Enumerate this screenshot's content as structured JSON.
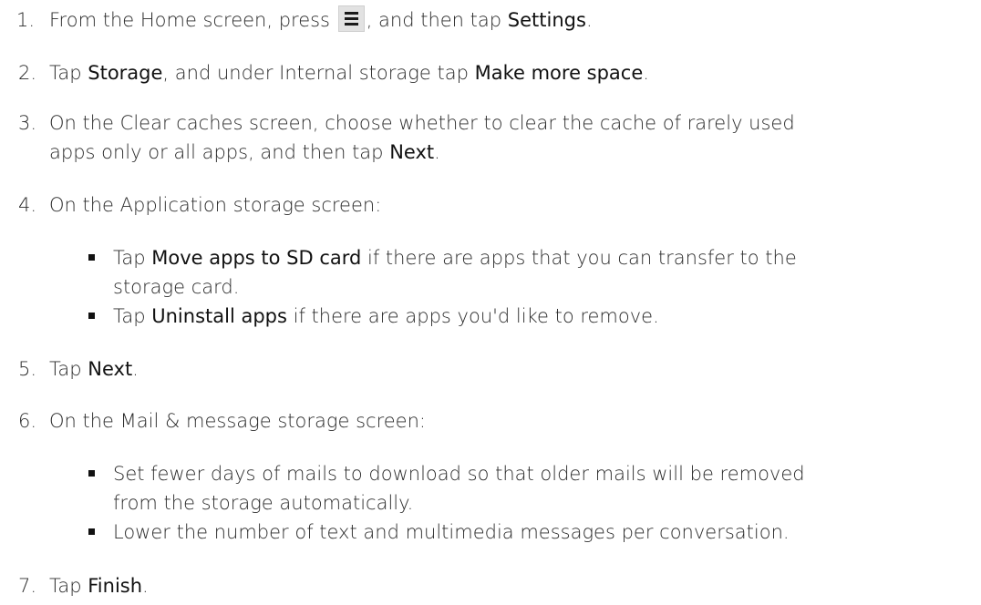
{
  "steps": [
    {
      "num": "1.",
      "pre": "From the Home screen, press",
      "icon": "menu-icon",
      "mid": ", and then tap",
      "b1": "Settings",
      "post": "."
    },
    {
      "num": "2.",
      "pre": "Tap",
      "b1": "Storage",
      "mid": ", and under Internal storage tap",
      "b2": "Make more space",
      "post": "."
    },
    {
      "num": "3.",
      "line1": "On the Clear caches screen, choose whether to clear the cache of rarely used",
      "line2_pre": "apps only or all apps, and then tap",
      "b1": "Next",
      "post": "."
    },
    {
      "num": "4.",
      "text": "On the Application storage screen:",
      "bullets": [
        {
          "pre": "Tap",
          "b1": "Move apps to SD card",
          "post1": "if there are apps that you can transfer to the",
          "line2": "storage card."
        },
        {
          "pre": "Tap",
          "b1": "Uninstall apps",
          "post1": "if there are apps you'd like to remove."
        }
      ]
    },
    {
      "num": "5.",
      "pre": "Tap",
      "b1": "Next",
      "post": "."
    },
    {
      "num": "6.",
      "text": "On the Mail & message storage screen:",
      "bullets": [
        {
          "line1": "Set fewer days of mails to download so that older mails will be removed",
          "line2": "from the storage automatically."
        },
        {
          "line1": "Lower the number of text and multimedia messages per conversation."
        }
      ]
    },
    {
      "num": "7.",
      "pre": "Tap",
      "b1": "Finish",
      "post": "."
    }
  ]
}
